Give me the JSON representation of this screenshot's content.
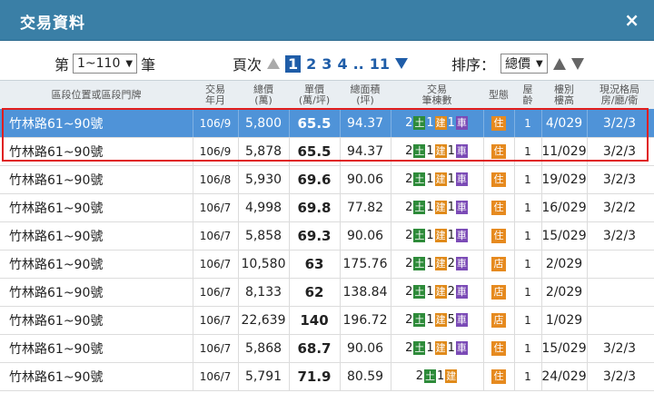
{
  "window": {
    "title": "交易資料",
    "close_label": "×"
  },
  "pager": {
    "prefix": "第",
    "range_value": "1~110",
    "suffix": "筆",
    "page_label": "頁次",
    "current_page": "1",
    "pages": [
      "2",
      "3",
      "4"
    ],
    "ellipsis": "..",
    "last_page": "11",
    "sort_label": "排序：",
    "sort_value": "總價"
  },
  "headers": {
    "addr": "區段位置或區段門牌",
    "date": [
      "交易",
      "年月"
    ],
    "total": [
      "總價",
      "(萬)"
    ],
    "unit": [
      "單價",
      "(萬/坪)"
    ],
    "area": [
      "總面積",
      "(坪)"
    ],
    "count": [
      "交易",
      "筆棟數"
    ],
    "type": "型態",
    "age": [
      "屋",
      "齡"
    ],
    "floor": [
      "樓別",
      "樓高"
    ],
    "layout": [
      "現況格局",
      "房/廳/衛"
    ]
  },
  "badges": {
    "land": "土",
    "building": "建",
    "car": "車"
  },
  "rows": [
    {
      "addr": "竹林路61~90號",
      "date": "106/9",
      "total": "5,800",
      "unit": "65.5",
      "area": "94.37",
      "land": "2",
      "bld": "1",
      "car": "1",
      "type": "住",
      "age": "1",
      "floor": "4/029",
      "layout": "3/2/3"
    },
    {
      "addr": "竹林路61~90號",
      "date": "106/9",
      "total": "5,878",
      "unit": "65.5",
      "area": "94.37",
      "land": "2",
      "bld": "1",
      "car": "1",
      "type": "住",
      "age": "1",
      "floor": "11/029",
      "layout": "3/2/3"
    },
    {
      "addr": "竹林路61~90號",
      "date": "106/8",
      "total": "5,930",
      "unit": "69.6",
      "area": "90.06",
      "land": "2",
      "bld": "1",
      "car": "1",
      "type": "住",
      "age": "1",
      "floor": "19/029",
      "layout": "3/2/3"
    },
    {
      "addr": "竹林路61~90號",
      "date": "106/7",
      "total": "4,998",
      "unit": "69.8",
      "area": "77.82",
      "land": "2",
      "bld": "1",
      "car": "1",
      "type": "住",
      "age": "1",
      "floor": "16/029",
      "layout": "3/2/2"
    },
    {
      "addr": "竹林路61~90號",
      "date": "106/7",
      "total": "5,858",
      "unit": "69.3",
      "area": "90.06",
      "land": "2",
      "bld": "1",
      "car": "1",
      "type": "住",
      "age": "1",
      "floor": "15/029",
      "layout": "3/2/3"
    },
    {
      "addr": "竹林路61~90號",
      "date": "106/7",
      "total": "10,580",
      "unit": "63",
      "area": "175.76",
      "land": "2",
      "bld": "1",
      "car": "2",
      "type": "店",
      "age": "1",
      "floor": "2/029",
      "layout": ""
    },
    {
      "addr": "竹林路61~90號",
      "date": "106/7",
      "total": "8,133",
      "unit": "62",
      "area": "138.84",
      "land": "2",
      "bld": "1",
      "car": "2",
      "type": "店",
      "age": "1",
      "floor": "2/029",
      "layout": ""
    },
    {
      "addr": "竹林路61~90號",
      "date": "106/7",
      "total": "22,639",
      "unit": "140",
      "area": "196.72",
      "land": "2",
      "bld": "1",
      "car": "5",
      "type": "店",
      "age": "1",
      "floor": "1/029",
      "layout": ""
    },
    {
      "addr": "竹林路61~90號",
      "date": "106/7",
      "total": "5,868",
      "unit": "68.7",
      "area": "90.06",
      "land": "2",
      "bld": "1",
      "car": "1",
      "type": "住",
      "age": "1",
      "floor": "15/029",
      "layout": "3/2/3"
    },
    {
      "addr": "竹林路61~90號",
      "date": "106/7",
      "total": "5,791",
      "unit": "71.9",
      "area": "80.59",
      "land": "2",
      "bld": "1",
      "car": "",
      "type": "住",
      "age": "1",
      "floor": "24/029",
      "layout": "3/2/3"
    }
  ],
  "colors": {
    "titlebar": "#3a7fa6",
    "selected_row": "#4f93d8",
    "highlight_border": "#e01e1e",
    "land_badge": "#2e8b3a",
    "building_badge": "#e08a1a",
    "car_badge": "#7b4bb6",
    "type_tag": "#e68a1f"
  }
}
